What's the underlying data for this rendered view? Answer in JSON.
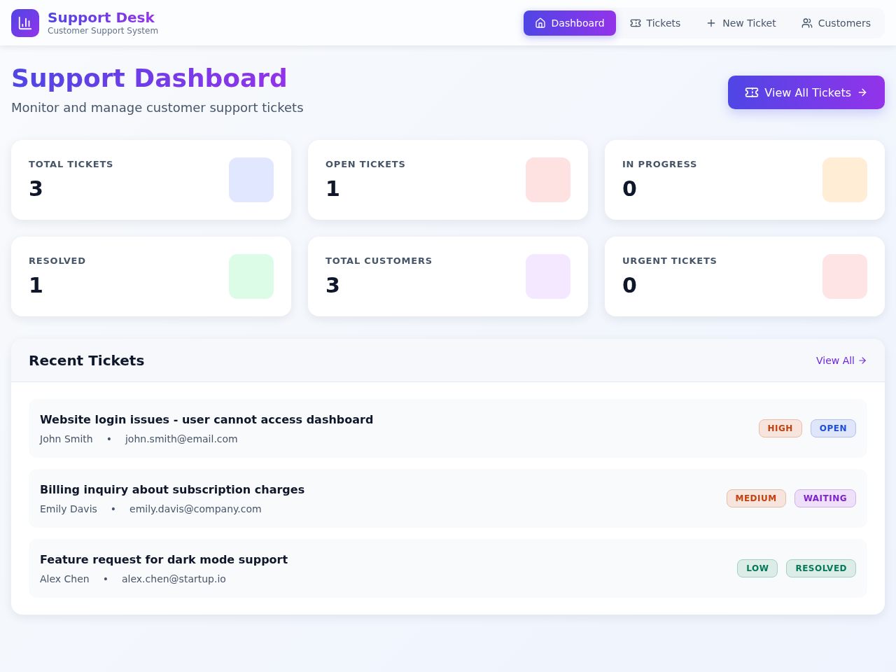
{
  "header": {
    "title": "Support Desk",
    "subtitle": "Customer Support System"
  },
  "nav": [
    {
      "label": "Dashboard",
      "selected": true
    },
    {
      "label": "Tickets",
      "selected": false
    },
    {
      "label": "New Ticket",
      "selected": false
    },
    {
      "label": "Customers",
      "selected": false
    }
  ],
  "page": {
    "title": "Support Dashboard",
    "subtitle": "Monitor and manage customer support tickets",
    "action": "View All Tickets"
  },
  "stats": [
    {
      "label": "TOTAL TICKETS",
      "value": "3",
      "color": "#e0e7ff"
    },
    {
      "label": "OPEN TICKETS",
      "value": "1",
      "color": "#fee2e2"
    },
    {
      "label": "IN PROGRESS",
      "value": "0",
      "color": "#ffedd5"
    },
    {
      "label": "RESOLVED",
      "value": "1",
      "color": "#dcfce7"
    },
    {
      "label": "TOTAL CUSTOMERS",
      "value": "3",
      "color": "#f3e8ff"
    },
    {
      "label": "URGENT TICKETS",
      "value": "0",
      "color": "#ffe4e6"
    }
  ],
  "recent": {
    "title": "Recent Tickets",
    "link": "View All",
    "tickets": [
      {
        "title": "Website login issues - user cannot access dashboard",
        "customer": "John Smith",
        "separator": "•",
        "email": "john.smith@email.com",
        "badges": [
          {
            "label": "HIGH",
            "color": "#c2410c"
          },
          {
            "label": "OPEN",
            "color": "#1d4ed8"
          }
        ]
      },
      {
        "title": "Billing inquiry about subscription charges",
        "customer": "Emily Davis",
        "separator": "•",
        "email": "emily.davis@company.com",
        "badges": [
          {
            "label": "MEDIUM",
            "color": "#c2410c"
          },
          {
            "label": "WAITING",
            "color": "#7e22ce"
          }
        ]
      },
      {
        "title": "Feature request for dark mode support",
        "customer": "Alex Chen",
        "separator": "•",
        "email": "alex.chen@startup.io",
        "badges": [
          {
            "label": "LOW",
            "color": "#047857"
          },
          {
            "label": "RESOLVED",
            "color": "#047857"
          }
        ]
      }
    ]
  }
}
